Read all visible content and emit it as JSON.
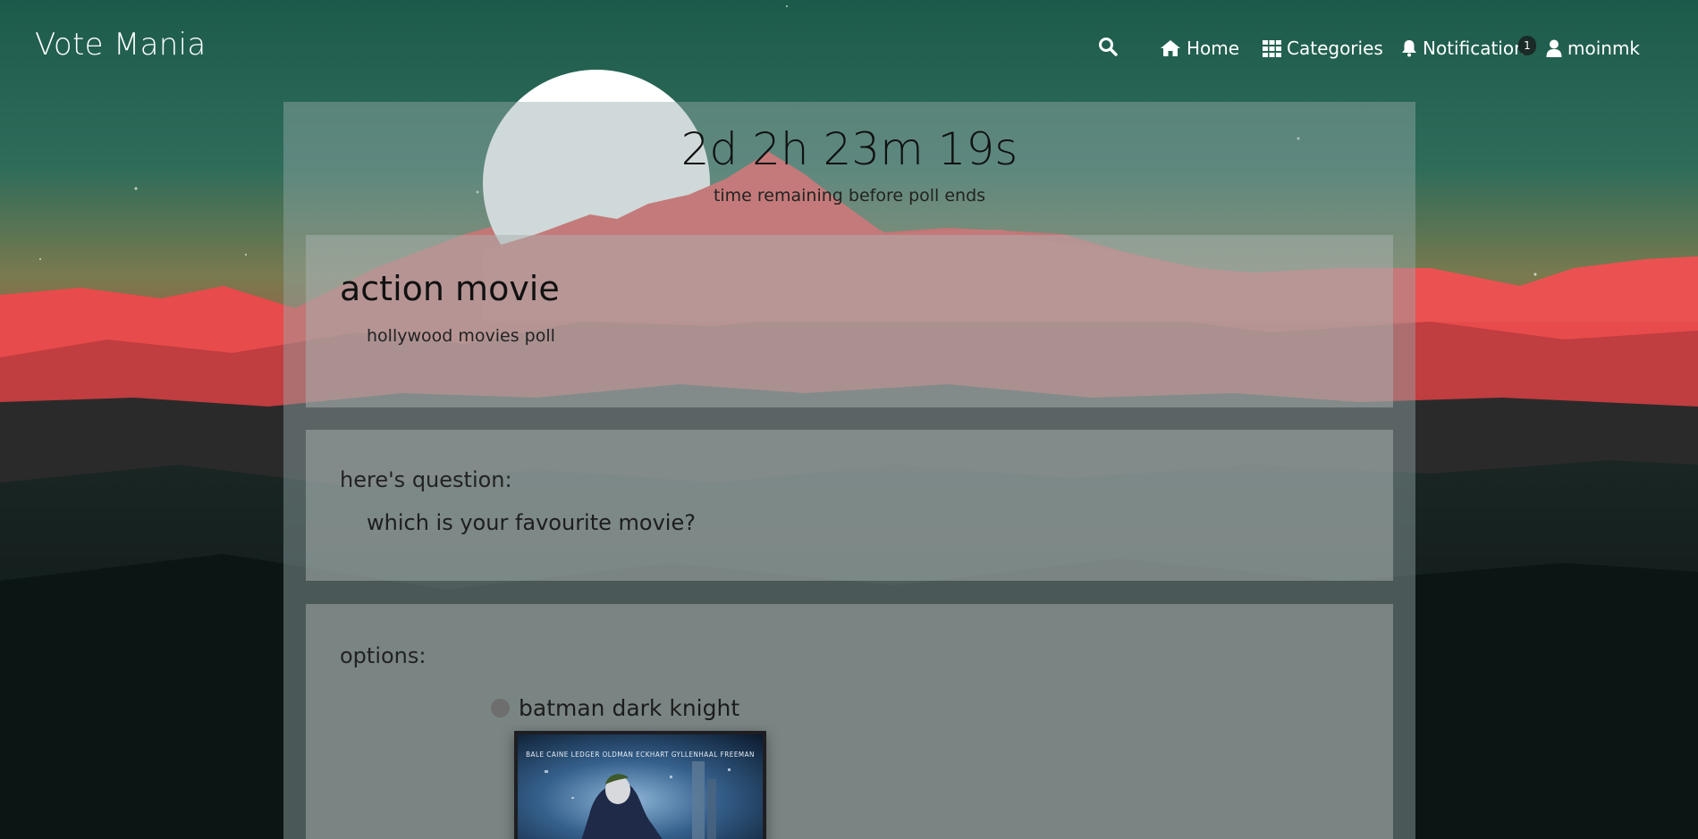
{
  "app": {
    "title": "Vote Mania"
  },
  "nav": {
    "search_icon": "search-icon",
    "items": [
      {
        "label": "Home",
        "icon": "home-icon"
      },
      {
        "label": "Categories",
        "icon": "grid-icon"
      },
      {
        "label": "Notification",
        "icon": "bell-icon",
        "badge": "1"
      },
      {
        "label": "moinmk",
        "icon": "user-icon"
      }
    ]
  },
  "timer": {
    "value": "2d 2h 23m 19s",
    "caption": "time remaining before poll ends"
  },
  "poll": {
    "title": "action movie",
    "category": "hollywood movies poll"
  },
  "question": {
    "label": "here's question:",
    "text": "which is your favourite movie?"
  },
  "options": {
    "label": "options:",
    "items": [
      {
        "text": "batman dark knight",
        "poster_credits": "BALE  CAINE  LEDGER  OLDMAN  ECKHART  GYLLENHAAL  FREEMAN"
      }
    ]
  },
  "colors": {
    "sky_top": "#1c5a4b",
    "mountain_red": "#e84b4b",
    "mountain_pink": "#f4a3a6",
    "sun": "#ffffff",
    "dark_green": "#0e1a18"
  }
}
